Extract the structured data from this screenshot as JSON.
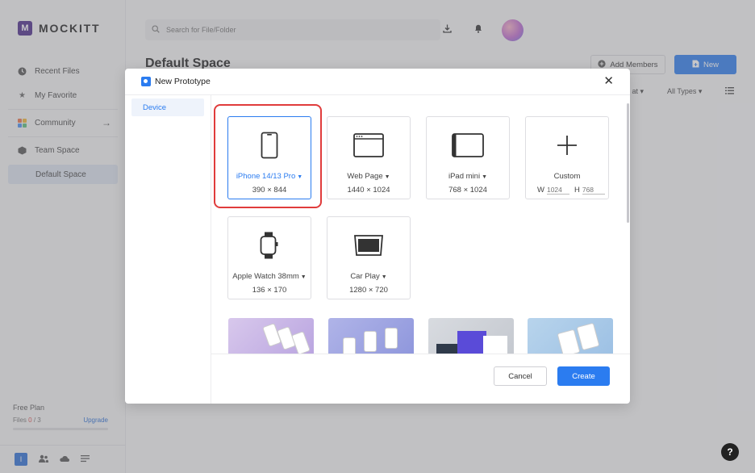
{
  "app": {
    "logo_letter": "M",
    "logo_text": "MOCKITT"
  },
  "sidebar": {
    "items": [
      {
        "label": "Recent Files",
        "icon": "clock-icon"
      },
      {
        "label": "My Favorite",
        "icon": "star-icon"
      },
      {
        "label": "Community",
        "icon": "community-icon"
      },
      {
        "label": "Team Space",
        "icon": "cube-icon"
      },
      {
        "label": "Default Space",
        "icon": ""
      }
    ],
    "plan": {
      "title": "Free Plan",
      "files_label": "Files",
      "files_used": "0",
      "files_total": "/ 3",
      "upgrade_label": "Upgrade"
    },
    "user_initial": "I"
  },
  "topbar": {
    "search_placeholder": "Search for File/Folder"
  },
  "main": {
    "title": "Default Space",
    "add_members_label": "Add Members",
    "new_label": "New",
    "sort_label": "d at",
    "types_label": "All Types"
  },
  "modal": {
    "title": "New Prototype",
    "nav_device": "Device",
    "devices": [
      {
        "name": "iPhone 14/13 Pro",
        "dims": "390 × 844",
        "selected": true,
        "icon": "phone-icon"
      },
      {
        "name": "Web Page",
        "dims": "1440 × 1024",
        "selected": false,
        "icon": "browser-icon"
      },
      {
        "name": "iPad mini",
        "dims": "768 × 1024",
        "selected": false,
        "icon": "tablet-icon"
      },
      {
        "name": "Custom",
        "selected": false,
        "icon": "plus-icon"
      },
      {
        "name": "Apple Watch 38mm",
        "dims": "136 × 170",
        "selected": false,
        "icon": "watch-icon"
      },
      {
        "name": "Car Play",
        "dims": "1280 × 720",
        "selected": false,
        "icon": "carplay-icon"
      }
    ],
    "custom": {
      "w_label": "W",
      "w_placeholder": "1024",
      "h_label": "H",
      "h_placeholder": "768"
    },
    "cancel_label": "Cancel",
    "create_label": "Create"
  },
  "help_label": "?",
  "colors": {
    "accent": "#2b7cf0",
    "highlight": "#e03c3c",
    "brand": "#4a2a8a"
  }
}
